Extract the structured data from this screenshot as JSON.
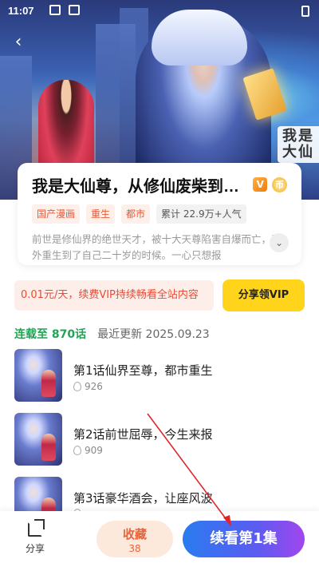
{
  "status_bar": {
    "time": "11:07"
  },
  "hero": {
    "poster_text": "我是大仙"
  },
  "book": {
    "title": "我是大仙尊，从修仙废柴到…",
    "vip_badge": "V",
    "coin_badge": "币",
    "tags": [
      "国产漫画",
      "重生",
      "都市"
    ],
    "popularity": "累计 22.9万+人气",
    "description": "前世是修仙界的绝世天才，被十大天尊陷害自爆而亡，意外重生到了自己二十岁的时候。一心只想报"
  },
  "vip_bar": {
    "text": "0.01元/天，续费VIP持续畅看全站内容",
    "share_button": "分享领VIP"
  },
  "serial": {
    "count_label": "连载至 870话",
    "updated_label": "最近更新 2025.09.23"
  },
  "episodes": [
    {
      "title": "第1话仙界至尊，都市重生",
      "views": "926"
    },
    {
      "title": "第2话前世屈辱，今生来报",
      "views": "909"
    },
    {
      "title": "第3话豪华酒会，让座风波",
      "views": ""
    }
  ],
  "bottom_bar": {
    "share_label": "分享",
    "collect_label": "收藏",
    "collect_count": "38",
    "continue_label": "续看第1集"
  },
  "colors": {
    "accent_orange": "#e55a3a",
    "green": "#1fa453",
    "vip_yellow": "#ffd41a",
    "annotation_red": "#e0262b"
  }
}
